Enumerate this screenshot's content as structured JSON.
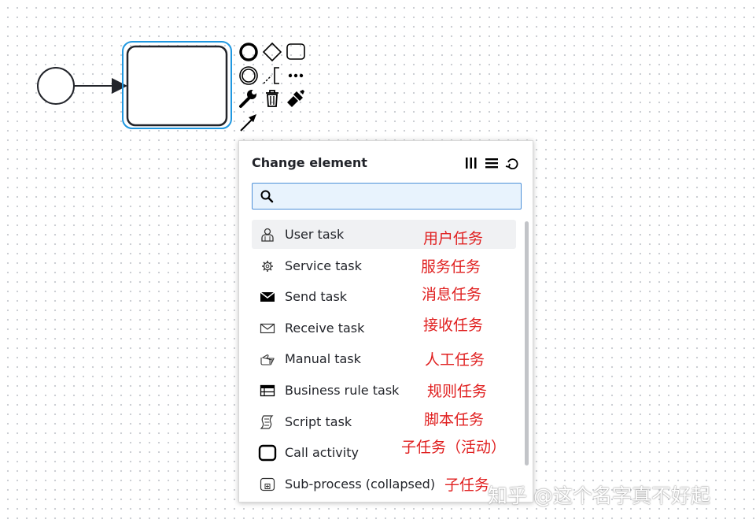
{
  "popup": {
    "title": "Change element",
    "search": {
      "value": "",
      "placeholder": ""
    },
    "entries": [
      {
        "label": "User task",
        "icon": "user-task-icon",
        "selected": true
      },
      {
        "label": "Service task",
        "icon": "service-task-icon"
      },
      {
        "label": "Send task",
        "icon": "send-task-icon"
      },
      {
        "label": "Receive task",
        "icon": "receive-task-icon"
      },
      {
        "label": "Manual task",
        "icon": "manual-task-icon"
      },
      {
        "label": "Business rule task",
        "icon": "business-rule-task-icon"
      },
      {
        "label": "Script task",
        "icon": "script-task-icon"
      },
      {
        "label": "Call activity",
        "icon": "call-activity-icon"
      },
      {
        "label": "Sub-process (collapsed)",
        "icon": "subprocess-collapsed-icon"
      }
    ],
    "header_icons": [
      "column-layout-icon",
      "list-layout-icon",
      "loop-icon"
    ]
  },
  "annotations": [
    "用户任务",
    "服务任务",
    "消息任务",
    "接收任务",
    "人工任务",
    "规则任务",
    "脚本任务",
    "子任务（活动）",
    "子任务"
  ],
  "watermark": "知乎 @这个名字真不好起",
  "colors": {
    "selection": "#1f97e0",
    "annotation": "#e02020",
    "search_border": "#4d90d8",
    "search_bg": "#e8f3fd"
  }
}
